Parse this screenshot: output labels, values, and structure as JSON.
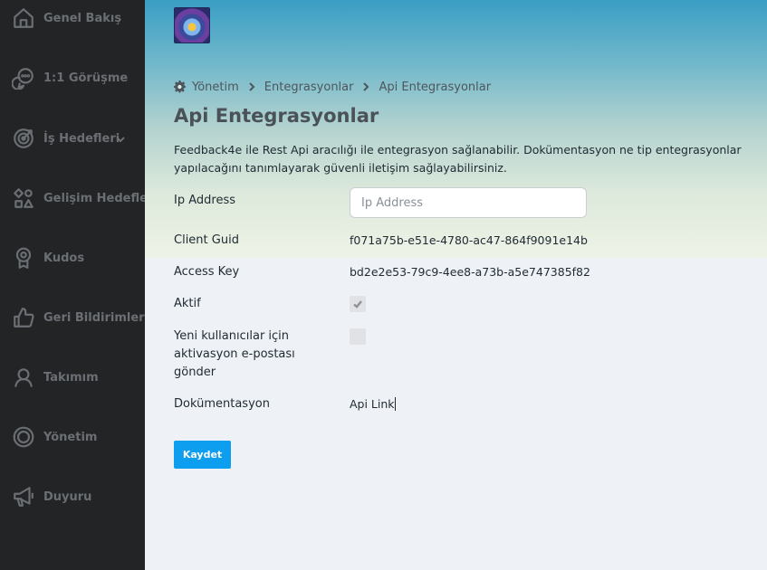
{
  "sidebar": {
    "items": [
      {
        "label": "Genel Bakış",
        "icon": "home-icon"
      },
      {
        "label": "1:1 Görüşme",
        "icon": "chat-bubbles-icon"
      },
      {
        "label": "İş Hedefleri",
        "icon": "target-icon",
        "expandable": true
      },
      {
        "label": "Gelişim Hedefleri",
        "icon": "shapes-icon"
      },
      {
        "label": "Kudos",
        "icon": "award-badge-icon"
      },
      {
        "label": "Geri Bildirimler",
        "icon": "thumbs-up-icon"
      },
      {
        "label": "Takımım",
        "icon": "user-icon"
      },
      {
        "label": "Yönetim",
        "icon": "settings-icon"
      },
      {
        "label": "Duyuru",
        "icon": "megaphone-icon"
      }
    ]
  },
  "breadcrumb": {
    "items": [
      "Yönetim",
      "Entegrasyonlar",
      "Api Entegrasyonlar"
    ]
  },
  "page": {
    "title": "Api Entegrasyonlar",
    "description": "Feedback4e ile Rest Api aracılığı ile entegrasyon sağlanabilir. Dokümentasyon ne tip entegrasyonlar yapılacağını tanımlayarak güvenli iletişim sağlayabilirsiniz."
  },
  "form": {
    "ip_label": "Ip Address",
    "ip_placeholder": "Ip Address",
    "ip_value": "",
    "client_guid_label": "Client Guid",
    "client_guid_value": "f071a75b-e51e-4780-ac47-864f9091e14b",
    "access_key_label": "Access Key",
    "access_key_value": "bd2e2e53-79c9-4ee8-a73b-a5e747385f82",
    "active_label": "Aktif",
    "active_checked": true,
    "send_email_label": "Yeni kullanıcılar için aktivasyon e-postası gönder",
    "send_email_checked": false,
    "docs_label": "Dokümentasyon",
    "docs_link_text": "Api Link",
    "save_label": "Kaydet"
  },
  "colors": {
    "sidebar_bg": "#222426",
    "sidebar_text": "#6b6f73",
    "primary_button": "#0d9ef0",
    "page_bg": "#eef1f5"
  }
}
